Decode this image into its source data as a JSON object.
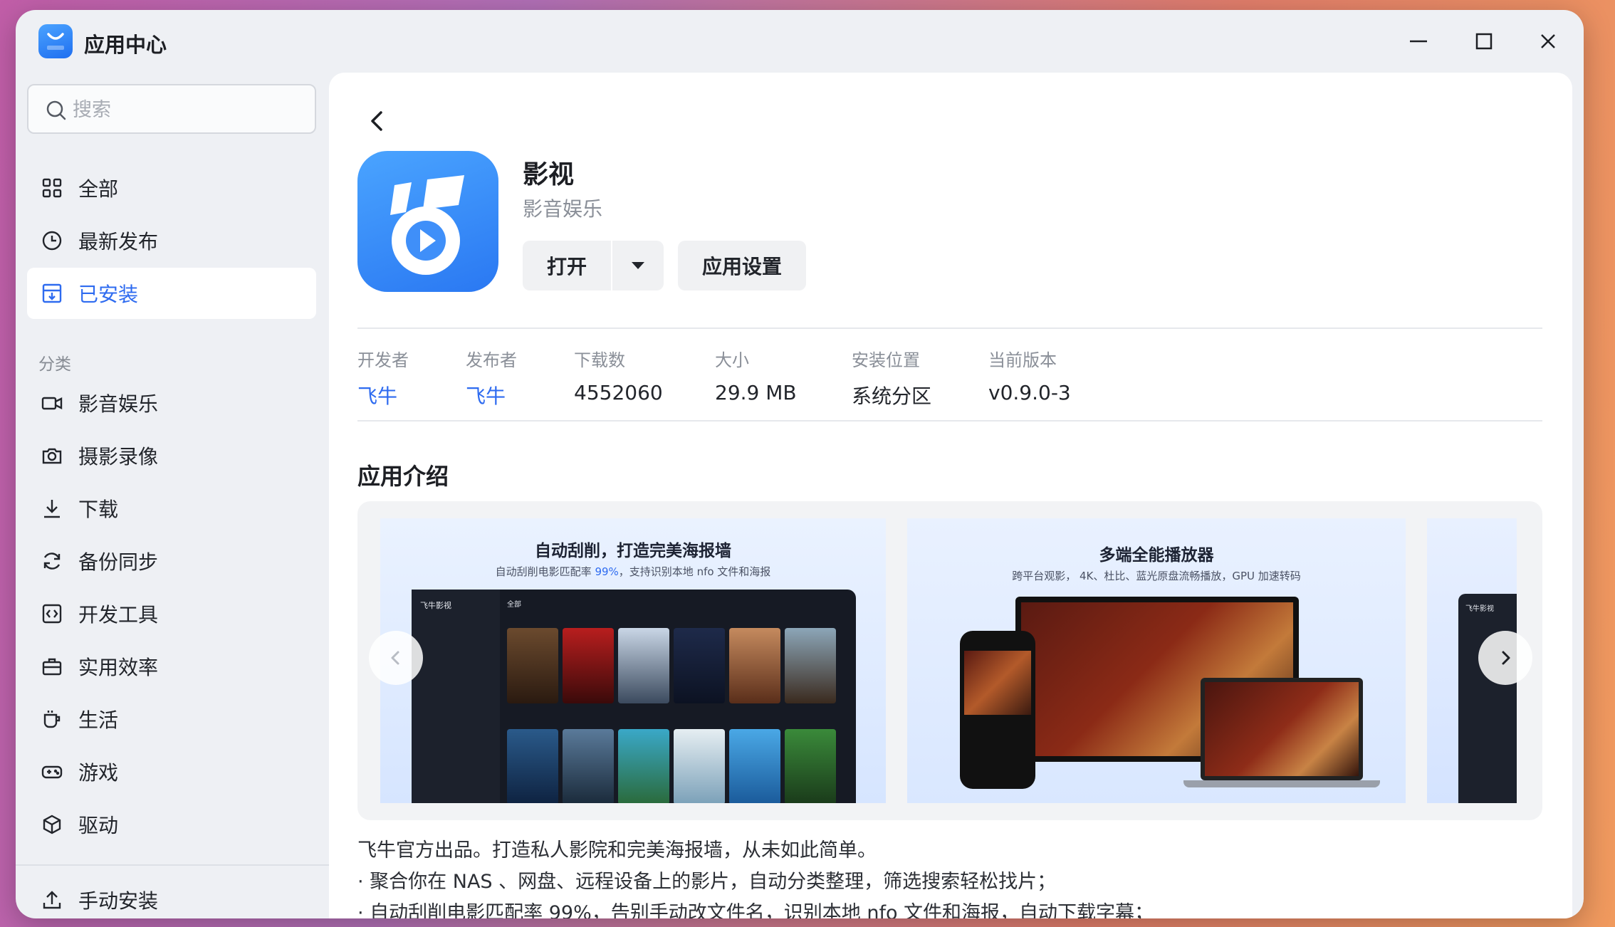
{
  "window": {
    "title": "应用中心"
  },
  "sidebar": {
    "search_placeholder": "搜索",
    "main_items": [
      {
        "label": "全部",
        "icon": "grid-icon"
      },
      {
        "label": "最新发布",
        "icon": "clock-icon"
      },
      {
        "label": "已安装",
        "icon": "installed-icon",
        "active": true
      }
    ],
    "category_label": "分类",
    "categories": [
      {
        "label": "影音娱乐",
        "icon": "video-camera-icon"
      },
      {
        "label": "摄影录像",
        "icon": "camera-icon"
      },
      {
        "label": "下载",
        "icon": "download-icon"
      },
      {
        "label": "备份同步",
        "icon": "sync-icon"
      },
      {
        "label": "开发工具",
        "icon": "code-icon"
      },
      {
        "label": "实用效率",
        "icon": "toolbox-icon"
      },
      {
        "label": "生活",
        "icon": "cup-icon"
      },
      {
        "label": "游戏",
        "icon": "gamepad-icon"
      },
      {
        "label": "驱动",
        "icon": "cube-icon"
      }
    ],
    "manual_install": "手动安装"
  },
  "app": {
    "name": "影视",
    "category": "影音娱乐",
    "open_label": "打开",
    "settings_label": "应用设置",
    "meta": [
      {
        "key": "开发者",
        "value": "飞牛",
        "link": true
      },
      {
        "key": "发布者",
        "value": "飞牛",
        "link": true
      },
      {
        "key": "下载数",
        "value": "4552060"
      },
      {
        "key": "大小",
        "value": "29.9 MB"
      },
      {
        "key": "安装位置",
        "value": "系统分区"
      },
      {
        "key": "当前版本",
        "value": "v0.9.0-3"
      }
    ],
    "intro_title": "应用介绍",
    "screenshots": [
      {
        "title": "自动刮削，打造完美海报墙",
        "subtitle_pre": "自动刮削电影匹配率 ",
        "subtitle_hl": "99%",
        "subtitle_post": "，支持识别本地 nfo 文件和海报",
        "brand": "飞牛影视",
        "tab": "全部"
      },
      {
        "title": "多端全能播放器",
        "subtitle": "跨平台观影， 4K、杜比、蓝光原盘流畅播放，GPU 加速转码"
      },
      {
        "brand": "飞牛影视"
      }
    ],
    "description": [
      "飞牛官方出品。打造私人影院和完美海报墙，从未如此简单。",
      "· 聚合你在 NAS 、网盘、远程设备上的影片，自动分类整理，筛选搜索轻松找片；",
      "· 自动刮削电影匹配率 99%，告别手动改文件名，识别本地 nfo 文件和海报，自动下载字幕；"
    ]
  },
  "colors": {
    "accent": "#2e6bf0",
    "active_bg": "#ffffff",
    "sidebar_bg": "#eef0f4"
  }
}
